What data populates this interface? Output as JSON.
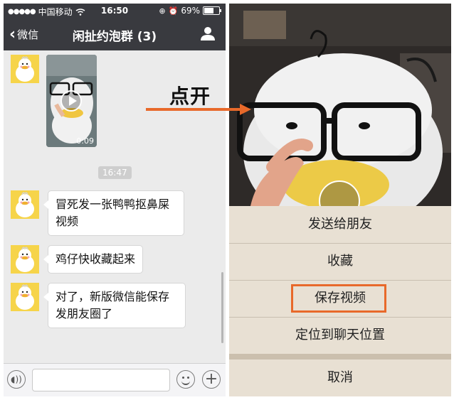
{
  "status": {
    "carrier": "中国移动",
    "time": "16:50",
    "battery": "69%"
  },
  "navbar": {
    "back_label": "微信",
    "title": "闲扯约泡群 (3)"
  },
  "video": {
    "duration": "0:09"
  },
  "timestamp": "16:47",
  "messages": [
    {
      "text": "冒死发一张鸭鸭抠鼻屎视频"
    },
    {
      "text": "鸡仔快收藏起来"
    },
    {
      "text": "对了，新版微信能保存发朋友圈了"
    }
  ],
  "annotation": {
    "label": "点开"
  },
  "sheet": {
    "items": [
      {
        "label": "发送给朋友"
      },
      {
        "label": "收藏"
      },
      {
        "label": "保存视频"
      },
      {
        "label": "定位到聊天位置"
      }
    ],
    "cancel": "取消"
  },
  "colors": {
    "highlight": "#e8692a",
    "navbar": "#393a3f",
    "avatar": "#f6d44a"
  }
}
